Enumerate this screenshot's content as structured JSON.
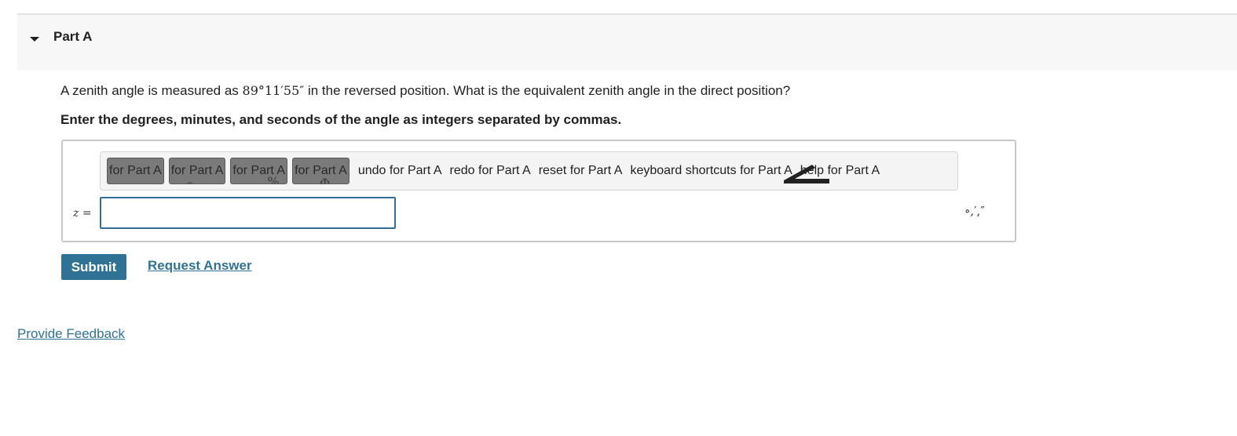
{
  "part": {
    "title": "Part A",
    "caret_icon": "caret-down-icon"
  },
  "question": {
    "before": "A zenith angle is measured as ",
    "angle": "89°11′55″",
    "after": " in the reversed position. What is the equivalent zenith angle in the direct position?"
  },
  "instruction": "Enter the degrees, minutes, and seconds of the angle as integers separated by commas.",
  "toolbar": {
    "buttons": [
      {
        "label": "for Part A",
        "icon": "template-icon"
      },
      {
        "label": "for Part A",
        "icon": "superscript-icon"
      },
      {
        "label": "for Part A",
        "icon": "vector-icon"
      },
      {
        "label": "for Part A",
        "icon": "symbols-icon"
      }
    ],
    "undo": "undo for Part A",
    "redo": "redo for Part A",
    "reset": "reset for Part A",
    "keyboard": "keyboard shortcuts for Part A",
    "help": "help for Part A",
    "undo_icon": "undo-arrow-icon"
  },
  "answer": {
    "variable": "z",
    "equals": "=",
    "value": "",
    "units": "∘,′,″"
  },
  "actions": {
    "submit": "Submit",
    "request_answer": "Request Answer"
  },
  "footer": {
    "feedback": "Provide Feedback"
  },
  "colors": {
    "accent": "#2f7296",
    "input_border": "#2f6f9a",
    "header_bg": "#f7f7f7"
  }
}
